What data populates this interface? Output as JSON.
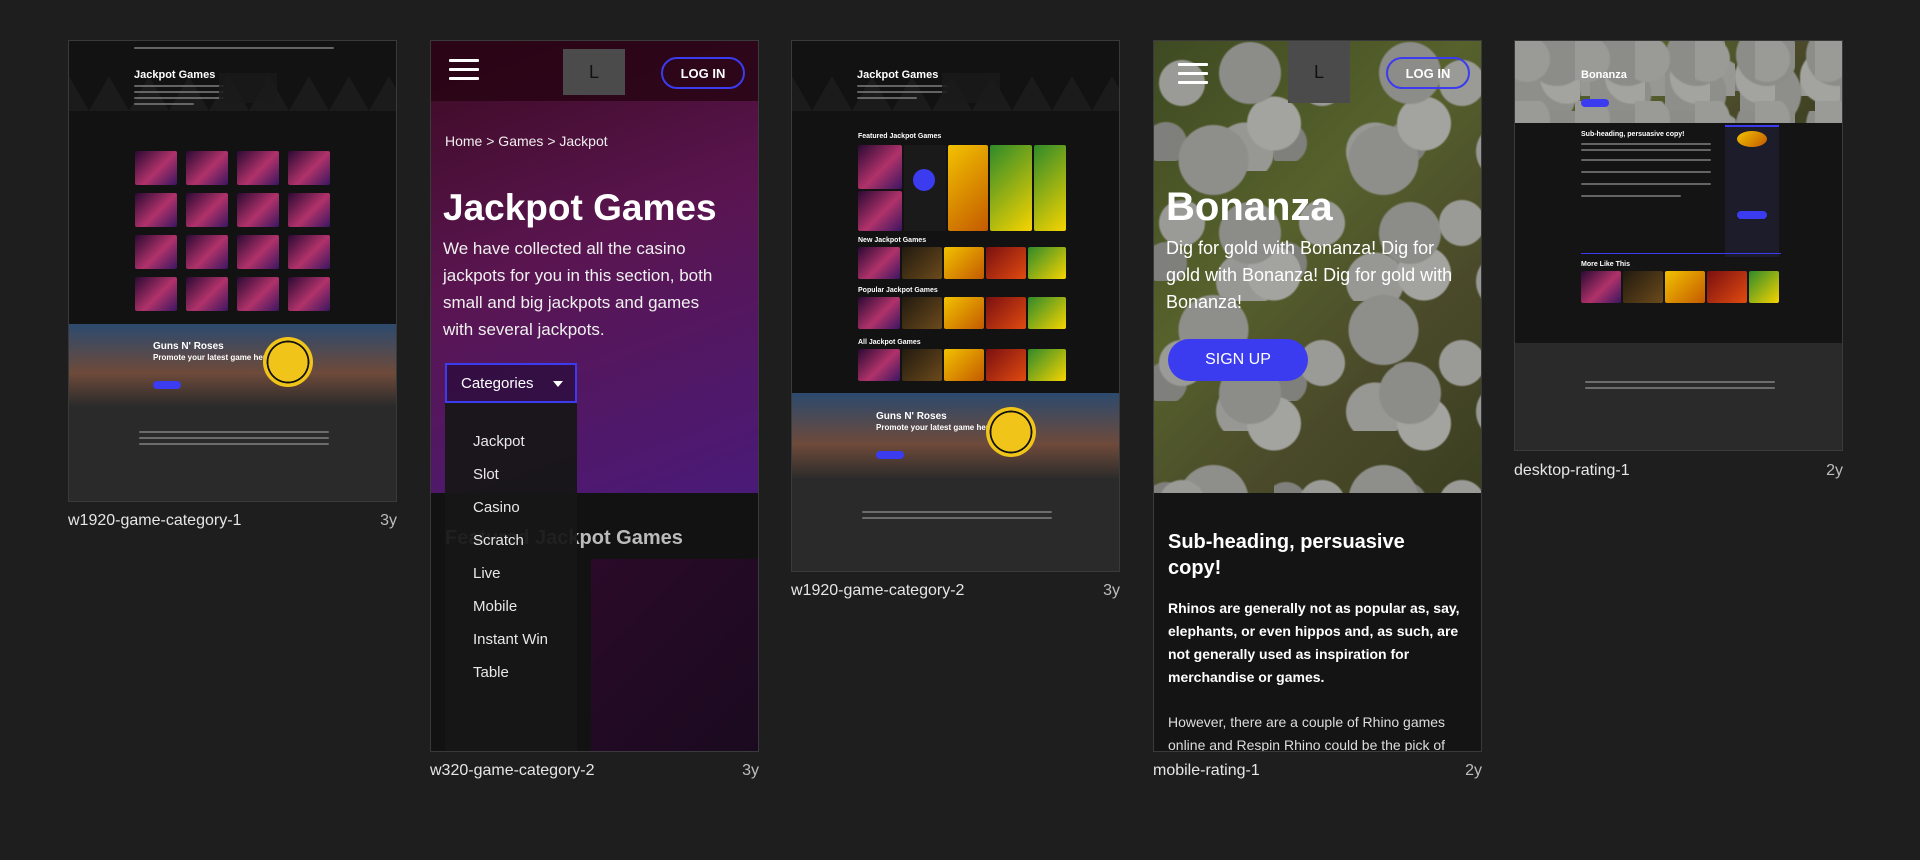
{
  "cards": [
    {
      "caption": "w1920-game-category-1",
      "age": "3y"
    },
    {
      "caption": "w320-game-category-2",
      "age": "3y"
    },
    {
      "caption": "w1920-game-category-2",
      "age": "3y"
    },
    {
      "caption": "mobile-rating-1",
      "age": "2y"
    },
    {
      "caption": "desktop-rating-1",
      "age": "2y"
    }
  ],
  "c1": {
    "hero_title": "Jackpot Games",
    "banner_title": "Guns N' Roses",
    "banner_sub": "Promote your latest game here"
  },
  "c2": {
    "logo": "L",
    "login": "LOG IN",
    "breadcrumb": "Home > Games > Jackpot",
    "title": "Jackpot Games",
    "desc": "We have collected all the casino jackpots for you in this section, both small and big jackpots and games with several jackpots.",
    "categories_label": "Categories",
    "dropdown": [
      "Jackpot",
      "Slot",
      "Casino",
      "Scratch",
      "Live",
      "Mobile",
      "Instant Win",
      "Table"
    ],
    "featured": "Featured Jackpot Games"
  },
  "c3": {
    "hero_title": "Jackpot Games",
    "s1": "Featured Jackpot Games",
    "s2": "New Jackpot Games",
    "s3": "Popular Jackpot Games",
    "s4": "All Jackpot Games",
    "banner_title": "Guns N' Roses",
    "banner_sub": "Promote your latest game here"
  },
  "c4": {
    "logo": "L",
    "login": "LOG IN",
    "title": "Bonanza",
    "desc": "Dig for gold with Bonanza! Dig for gold with Bonanza! Dig for gold with Bonanza!",
    "signup": "SIGN UP",
    "subheading": "Sub-heading, persuasive copy!",
    "bold": "Rhinos are generally not as popular as, say, elephants, or even hippos and, as such, are not generally used as inspiration for merchandise or games.",
    "body": "However, there are a couple of Rhino games online and Respin Rhino could be the pick of"
  },
  "c5": {
    "title": "Bonanza",
    "subheading": "Sub-heading, persuasive copy!",
    "more": "More Like This"
  }
}
